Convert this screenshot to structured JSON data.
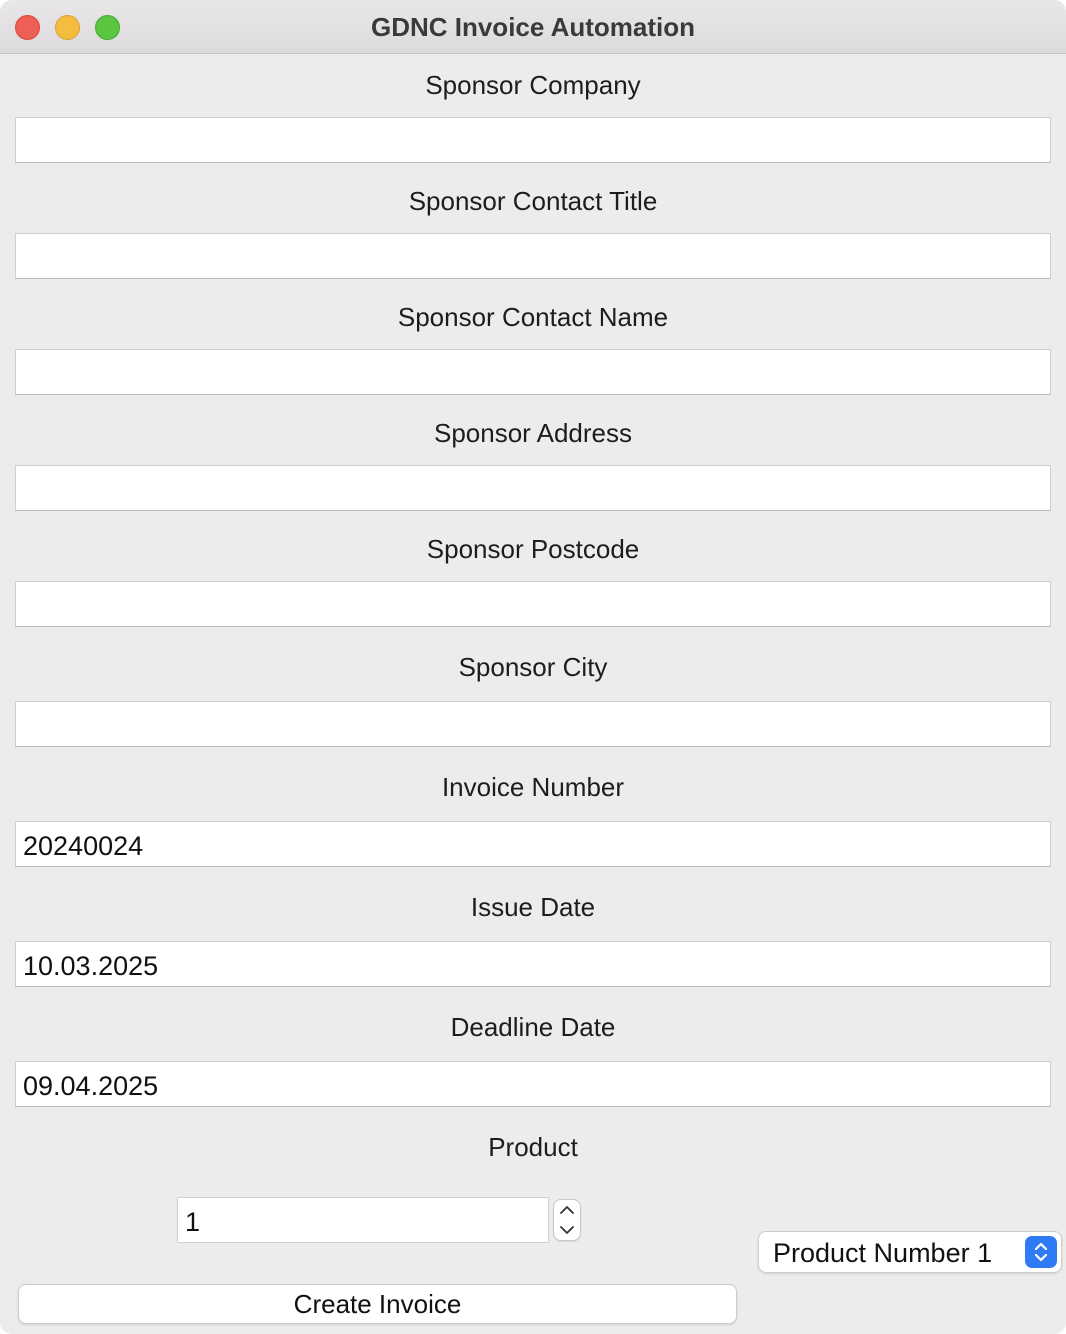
{
  "window": {
    "title": "GDNC Invoice Automation"
  },
  "fields": {
    "sponsor_company": {
      "label": "Sponsor Company",
      "value": ""
    },
    "sponsor_contact_title": {
      "label": "Sponsor Contact Title",
      "value": ""
    },
    "sponsor_contact_name": {
      "label": "Sponsor Contact Name",
      "value": ""
    },
    "sponsor_address": {
      "label": "Sponsor Address",
      "value": ""
    },
    "sponsor_postcode": {
      "label": "Sponsor Postcode",
      "value": ""
    },
    "sponsor_city": {
      "label": "Sponsor City",
      "value": ""
    },
    "invoice_number": {
      "label": "Invoice Number",
      "value": "20240024"
    },
    "issue_date": {
      "label": "Issue Date",
      "value": "10.03.2025"
    },
    "deadline_date": {
      "label": "Deadline Date",
      "value": "09.04.2025"
    }
  },
  "product": {
    "label": "Product",
    "quantity": "1",
    "selected": "Product Number 1"
  },
  "actions": {
    "create_label": "Create Invoice"
  },
  "colors": {
    "window_bg": "#ececec",
    "accent": "#2f7bf5",
    "close": "#ee5f57",
    "minimize": "#f5bd3f",
    "maximize": "#5ac540"
  },
  "icons": {
    "stepper_up": "chevron-up-icon",
    "stepper_down": "chevron-down-icon",
    "popup": "up-down-chevrons-icon"
  }
}
